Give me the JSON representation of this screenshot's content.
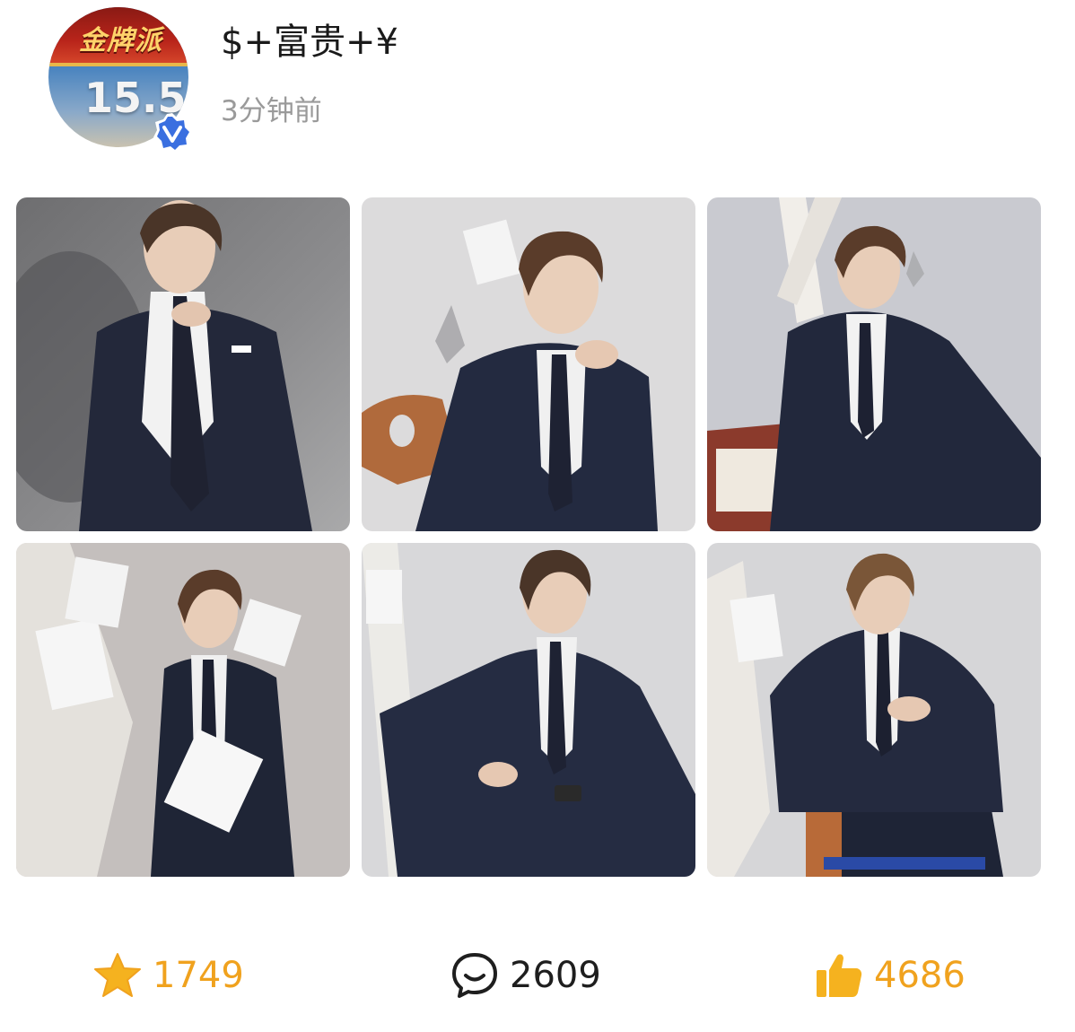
{
  "post": {
    "author": {
      "name": "$+富贵+¥",
      "avatar_banner_text": "金牌派",
      "avatar_number": "15.5",
      "verified": true,
      "verified_icon": "verified-v-badge-icon"
    },
    "time": "3分钟前",
    "photos": [
      {
        "name": "photo-1"
      },
      {
        "name": "photo-2"
      },
      {
        "name": "photo-3"
      },
      {
        "name": "photo-4"
      },
      {
        "name": "photo-5"
      },
      {
        "name": "photo-6"
      }
    ],
    "actions": {
      "favorite": {
        "icon": "star-icon",
        "count": "1749"
      },
      "comment": {
        "icon": "comment-bubble-icon",
        "count": "2609"
      },
      "like": {
        "icon": "thumbs-up-icon",
        "count": "4686"
      }
    }
  },
  "colors": {
    "accent": "#f0a21e",
    "verified": "#3a6fe0",
    "text_primary": "#1a1a1a",
    "text_secondary": "#9a9a9a"
  }
}
